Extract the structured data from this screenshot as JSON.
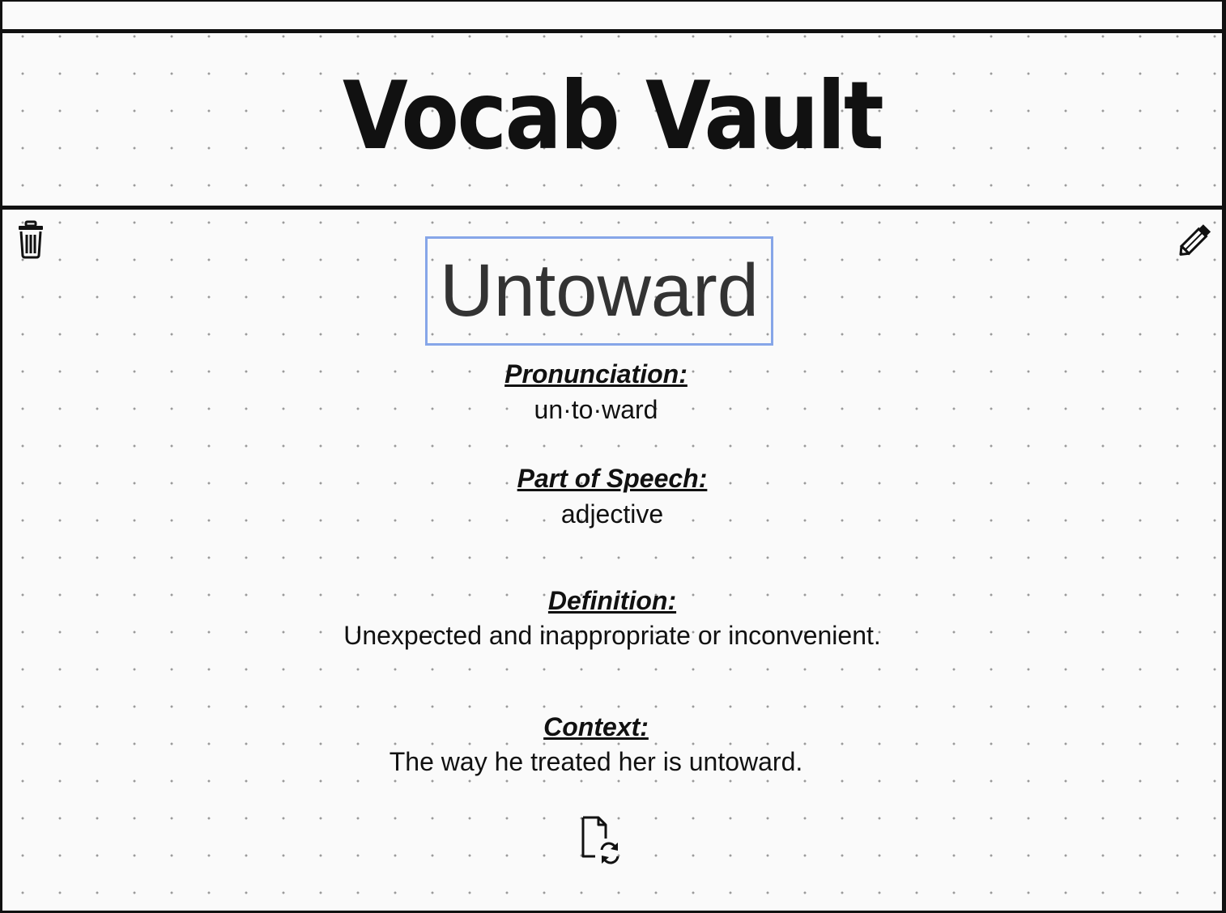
{
  "app": {
    "title": "Vocab Vault"
  },
  "card": {
    "word": "Untoward",
    "pronunciation_label": "Pronunciation:",
    "pronunciation": "un·to·ward",
    "part_of_speech_label": "Part of Speech:",
    "part_of_speech": "adjective",
    "definition_label": "Definition:",
    "definition": "Unexpected and inappropriate or inconvenient.",
    "context_label": "Context:",
    "context": "The way he treated her is untoward."
  },
  "icons": {
    "delete": "trash-icon",
    "edit": "pencil-icon",
    "regenerate": "file-refresh-icon"
  },
  "colors": {
    "ink": "#111111",
    "word_focus_border": "#86a6e8",
    "background": "#fafafa"
  }
}
